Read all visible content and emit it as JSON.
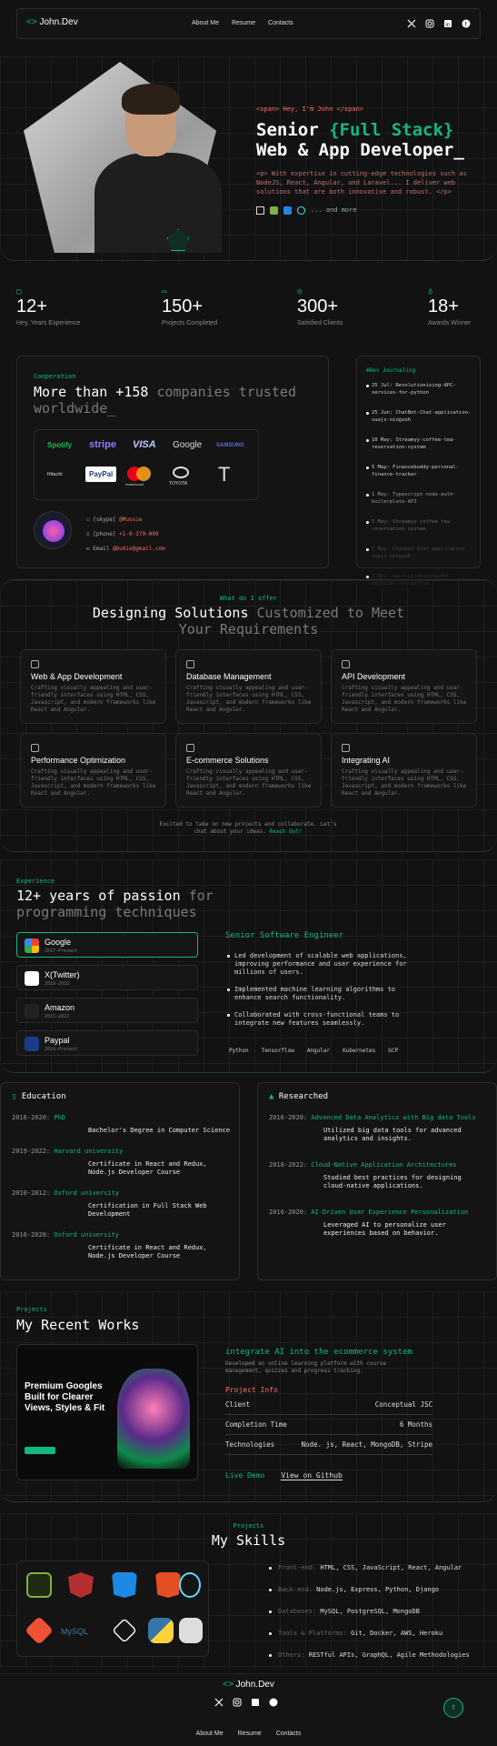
{
  "nav": {
    "logo_text": "John.Dev",
    "links": [
      "About Me",
      "Resume",
      "Contacts"
    ],
    "social_icons": [
      "x-icon",
      "instagram-icon",
      "linkedin-icon",
      "facebook-icon"
    ]
  },
  "hero": {
    "tag_line": "<span> Hey, I'm John </span>",
    "title_prefix": "Senior ",
    "title_highlight": "{Full Stack}",
    "title_line2": "Web & App Developer_",
    "desc": "<p> With expertise in cutting-edge technologies such as NodeJS, React, Angular, and Laravel... I deliver web solutions that are both innovative and robust. </p>",
    "tech_more": "... and more"
  },
  "stats": [
    {
      "num": "12+",
      "label": "Hey, Years Experience",
      "icon": "calendar-icon"
    },
    {
      "num": "150+",
      "label": "Projects Completed",
      "icon": "monitor-icon"
    },
    {
      "num": "300+",
      "label": "Satisfied Clients",
      "icon": "globe-icon"
    },
    {
      "num": "18+",
      "label": "Awards Winner",
      "icon": "award-icon"
    }
  ],
  "companies": {
    "eyebrow": "Cooperation",
    "title_white": "More than +158",
    "title_muted": "companies trusted",
    "title_line2": "worldwide_",
    "logos": [
      "Spotify",
      "stripe",
      "VISA",
      "Google",
      "SAMSUNG",
      "Hitachi",
      "PayPal",
      "mastercard",
      "TOYOTA",
      "TESLA"
    ],
    "contact": {
      "skype_label": "[skype]",
      "skype_value": "@Mussie",
      "phone_label": "[phone]",
      "phone_value": "+1-0-379-009",
      "email_label": "Email",
      "email_value": "@Dudio@gmail.com"
    }
  },
  "journal": {
    "title": "#Dev Journaling",
    "items": [
      "25 Jul: Revolutionizing-APC-services-for-python",
      "25 Jun: ChatBot-Chat-application-vuejs-ningsoh",
      "10 May: Streamyy-coffee-tea-reservation-system",
      "5 May: Financebuddy-personal-finance-tracker",
      "1 May: Typescript-node-auth-boilerplate-API",
      "5 May: Streamyy coffee tea reservation system",
      "5 May: Chatbot Chat application vuejs ningsoh",
      "1 May: Revolutionizing-APC-services-for-python"
    ]
  },
  "services": {
    "eyebrow": "What do I offer",
    "title_white": "Designing Solutions",
    "title_muted": "Customized to Meet",
    "title_line2": "Your Requirements",
    "items": [
      {
        "title": "Web & App Development",
        "icon": "code-icon"
      },
      {
        "title": "Database Management",
        "icon": "database-icon"
      },
      {
        "title": "API Development",
        "icon": "api-icon"
      },
      {
        "title": "Performance Optimization",
        "icon": "speed-icon"
      },
      {
        "title": "E-commerce Solutions",
        "icon": "cart-icon"
      },
      {
        "title": "Integrating AI",
        "icon": "ai-icon"
      }
    ],
    "item_desc": "Crafting visually appealing and user-friendly interfaces using HTML, CSS, Javascript, and modern frameworks like React and Angular.",
    "cta_text": "Excited to take on new projects and collaborate. Let's chat about your ideas.",
    "cta_link": "Reach Out!"
  },
  "experience": {
    "eyebrow": "Experience",
    "title_white": "12+ years of passion",
    "title_muted": "for",
    "title_line2": "programming techniques",
    "jobs": [
      {
        "name": "Google",
        "years": "2017-Present"
      },
      {
        "name": "X(Twitter)",
        "years": "2019-2022"
      },
      {
        "name": "Amazon",
        "years": "2015-2022"
      },
      {
        "name": "Paypal",
        "years": "2014-Present"
      }
    ],
    "role": "Senior Software Engineer",
    "bullets": [
      "Led development of scalable web applications, improving performance and user experience for millions of users.",
      "Implemented machine learning algorithms to enhance search functionality.",
      "Collaborated with cross-functional teams to integrate new features seamlessly."
    ],
    "tags": [
      "Python",
      "Tensorflow",
      "Angular",
      "Kubernetes",
      "GCP"
    ]
  },
  "education": {
    "title": "Education",
    "items": [
      {
        "years": "2016-2020:",
        "school": "PhD",
        "desc": "Bachelor's Degree in Computer Science"
      },
      {
        "years": "2019-2022:",
        "school": "Harvard university",
        "desc": "Certificate in React and Redux, Node.js Developer Course"
      },
      {
        "years": "2010-2012:",
        "school": "Oxford university",
        "desc": "Certification in Full Stack Web Development"
      },
      {
        "years": "2016-2020:",
        "school": "Oxford university",
        "desc": "Certificate in React and Redux, Node.js Developer Course"
      }
    ]
  },
  "research": {
    "title": "Researched",
    "items": [
      {
        "years": "2016-2020:",
        "topic": "Advanced Data Analytics with Big data Tools",
        "desc": "Utilized big data tools for advanced analytics and insights."
      },
      {
        "years": "2018-2022:",
        "topic": "Cloud-Native Application Architectures",
        "desc": "Studied best practices for designing cloud-native applications."
      },
      {
        "years": "2016-2020:",
        "topic": "AI-Driven User Experience Personalization",
        "desc": "Leveraged AI to personalize user experiences based on behavior."
      }
    ]
  },
  "projects": {
    "eyebrow": "Projects",
    "title": "My Recent Works",
    "shot_headline": "Premium Googles Built for Clearer Views, Styles & Fit",
    "name": "integrate AI into the ecommerce system",
    "desc": "Developed an online learning platform with course management, quizzes and progress tracking.",
    "info_title": "Project Info",
    "rows": [
      {
        "k": "Client",
        "v": "Conceptual JSC"
      },
      {
        "k": "Completion Time",
        "v": "6 Months"
      },
      {
        "k": "Technologies",
        "v": "Node. js, React, MongoDB, Stripe"
      }
    ],
    "live_demo": "Live Demo",
    "github": "View on Github"
  },
  "skills": {
    "eyebrow": "Projects",
    "title": "My Skills",
    "icons": [
      "nodejs-icon",
      "angular-icon",
      "css3-icon",
      "html5-icon",
      "react-icon",
      "git-icon",
      "mysql-icon",
      "kubernetes-icon",
      "python-icon",
      "express-icon"
    ],
    "list": [
      {
        "k": "Front-end:",
        "v": "HTML, CSS, JavaScript, React, Angular"
      },
      {
        "k": "Back-end:",
        "v": "Node.js, Express, Python, Django"
      },
      {
        "k": "Databases:",
        "v": "MySQL, PostgreSQL, MongoDB"
      },
      {
        "k": "Tools & Platforms:",
        "v": "Git, Docker, AWS, Heroku"
      },
      {
        "k": "Others:",
        "v": "RESTful APIs, GraphQL, Agile Methodologies"
      }
    ]
  },
  "footer": {
    "logo_text": "John.Dev",
    "links": [
      "About Me",
      "Resume",
      "Contacts"
    ]
  },
  "colors": {
    "accent": "#10b981",
    "bg": "#121212",
    "tag": "#ff6b6b"
  }
}
